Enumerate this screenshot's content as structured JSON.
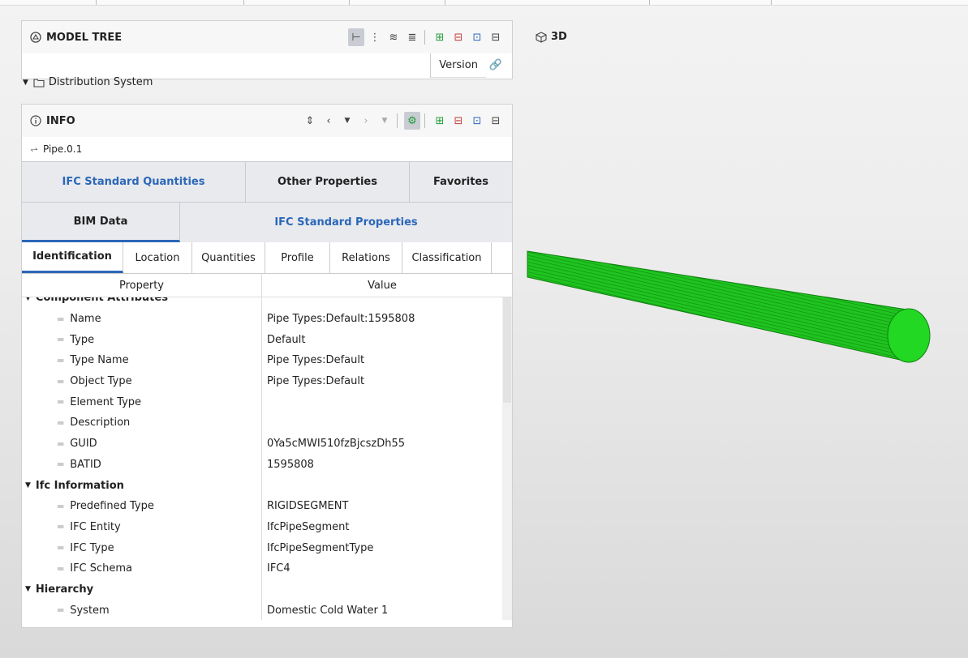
{
  "model_tree": {
    "title": "MODEL TREE",
    "version_label": "Version",
    "root_item": "Distribution System"
  },
  "info": {
    "title": "INFO",
    "object_name": "Pipe.0.1",
    "tabs_row1": [
      "IFC Standard Quantities",
      "Other Properties",
      "Favorites"
    ],
    "tabs_row2": [
      "BIM Data",
      "IFC Standard Properties"
    ],
    "subtabs": [
      "Identification",
      "Location",
      "Quantities",
      "Profile",
      "Relations",
      "Classification"
    ],
    "columns": {
      "property": "Property",
      "value": "Value"
    },
    "rows": [
      {
        "kind": "group",
        "name": "Component Attributes",
        "value": ""
      },
      {
        "kind": "leaf",
        "name": "Name",
        "value": "Pipe Types:Default:1595808"
      },
      {
        "kind": "leaf",
        "name": "Type",
        "value": "Default"
      },
      {
        "kind": "leaf",
        "name": "Type Name",
        "value": "Pipe Types:Default"
      },
      {
        "kind": "leaf",
        "name": "Object Type",
        "value": "Pipe Types:Default"
      },
      {
        "kind": "leaf",
        "name": "Element Type",
        "value": ""
      },
      {
        "kind": "leaf",
        "name": "Description",
        "value": ""
      },
      {
        "kind": "leaf",
        "name": "GUID",
        "value": "0Ya5cMWI510fzBjcszDh55"
      },
      {
        "kind": "leaf",
        "name": "BATID",
        "value": "1595808"
      },
      {
        "kind": "group",
        "name": "Ifc Information",
        "value": ""
      },
      {
        "kind": "leaf",
        "name": "Predefined Type",
        "value": "RIGIDSEGMENT"
      },
      {
        "kind": "leaf",
        "name": "IFC Entity",
        "value": "IfcPipeSegment"
      },
      {
        "kind": "leaf",
        "name": "IFC Type",
        "value": "IfcPipeSegmentType"
      },
      {
        "kind": "leaf",
        "name": "IFC Schema",
        "value": "IFC4"
      },
      {
        "kind": "group",
        "name": "Hierarchy",
        "value": ""
      },
      {
        "kind": "leaf",
        "name": "System",
        "value": "Domestic Cold Water 1"
      }
    ]
  },
  "viewer": {
    "label": "3D",
    "pipe_color": "#1fc41f"
  }
}
